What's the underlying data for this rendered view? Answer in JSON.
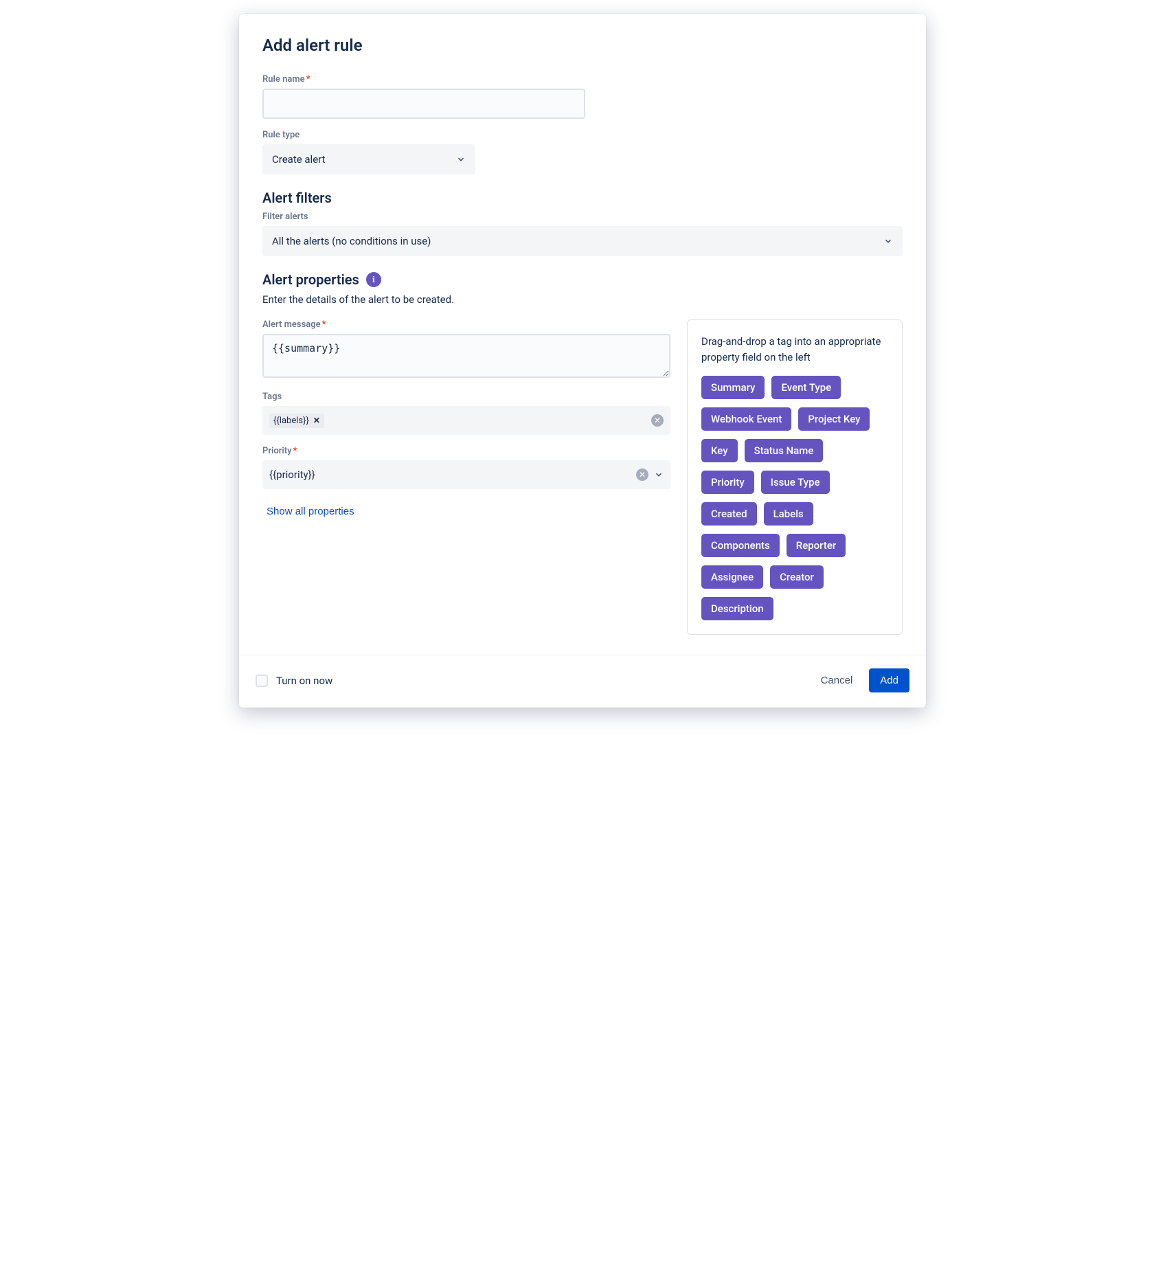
{
  "title": "Add alert rule",
  "ruleName": {
    "label": "Rule name",
    "required": true,
    "value": ""
  },
  "ruleType": {
    "label": "Rule type",
    "value": "Create alert"
  },
  "filters": {
    "heading": "Alert filters",
    "label": "Filter alerts",
    "value": "All the alerts (no conditions in use)"
  },
  "properties": {
    "heading": "Alert properties",
    "description": "Enter the details of the alert to be created.",
    "message": {
      "label": "Alert message",
      "required": true,
      "value": "{{summary}}"
    },
    "tags": {
      "label": "Tags",
      "chips": [
        "{{labels}}"
      ]
    },
    "priority": {
      "label": "Priority",
      "required": true,
      "value": "{{priority}}"
    },
    "showAll": "Show all properties"
  },
  "sidebar": {
    "hint": "Drag-and-drop a tag into an appropriate property field on the left",
    "tags": [
      "Summary",
      "Event Type",
      "Webhook Event",
      "Project Key",
      "Key",
      "Status Name",
      "Priority",
      "Issue Type",
      "Created",
      "Labels",
      "Components",
      "Reporter",
      "Assignee",
      "Creator",
      "Description"
    ]
  },
  "footer": {
    "turnOn": "Turn on now",
    "cancel": "Cancel",
    "add": "Add"
  }
}
